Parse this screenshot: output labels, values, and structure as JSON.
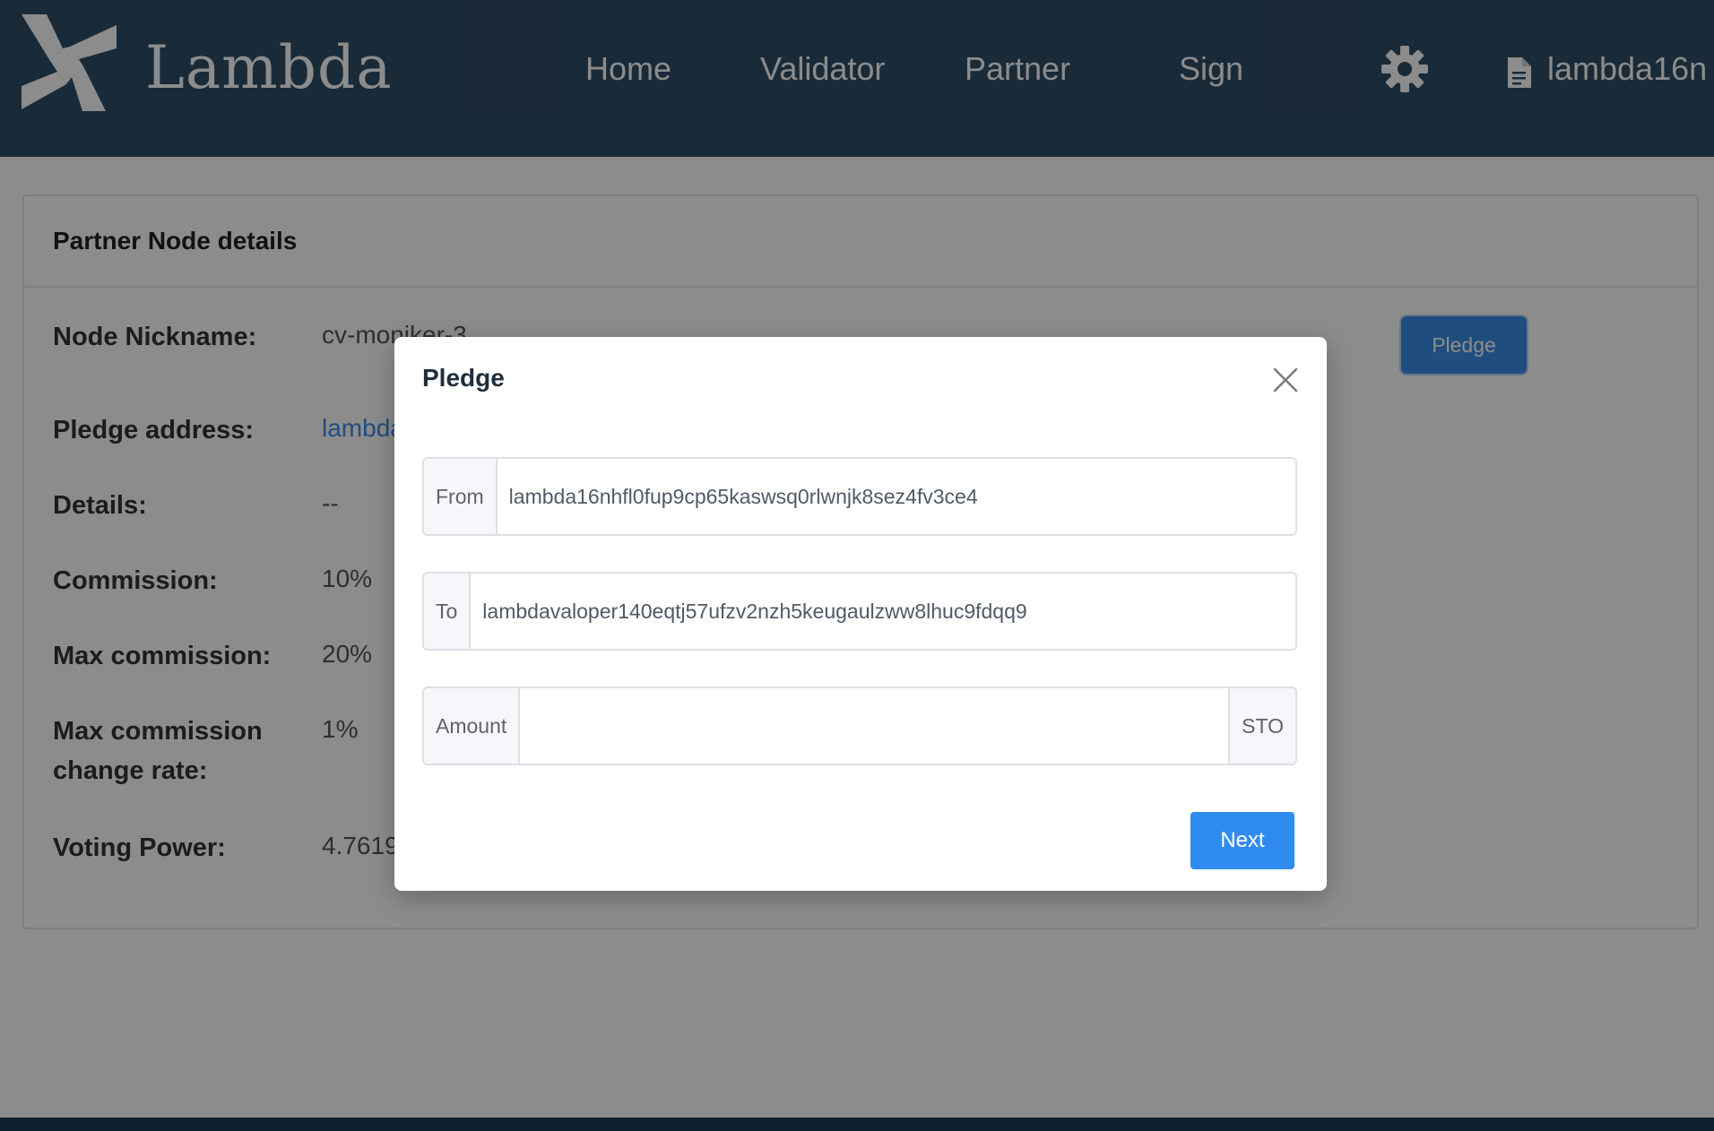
{
  "header": {
    "brand": "Lambda",
    "nav": [
      {
        "label": "Home"
      },
      {
        "label": "Validator"
      },
      {
        "label": "Partner"
      },
      {
        "label": "Sign"
      }
    ],
    "account_address": "lambda16n"
  },
  "card": {
    "title": "Partner Node details",
    "pledge_button": "Pledge",
    "rows": [
      {
        "label": "Node Nickname:",
        "value": "cv-moniker-3"
      },
      {
        "label": "Pledge address:",
        "value": "lambda"
      },
      {
        "label": "Details:",
        "value": "--"
      },
      {
        "label": "Commission:",
        "value": "10%"
      },
      {
        "label": "Max commission:",
        "value": "20%"
      },
      {
        "label": "Max commission change rate:",
        "value": "1%"
      },
      {
        "label": "Voting Power:",
        "value": "4.7619"
      }
    ]
  },
  "modal": {
    "title": "Pledge",
    "from_label": "From",
    "from_value": "lambda16nhfl0fup9cp65kaswsq0rlwnjk8sez4fv3ce4",
    "to_label": "To",
    "to_value": "lambdavaloper140eqtj57ufzv2nzh5keugaulzww8lhuc9fdqq9",
    "amount_label": "Amount",
    "amount_value": "",
    "amount_unit": "STO",
    "next_button": "Next"
  },
  "colors": {
    "header_bg": "#2f4d66",
    "primary": "#2f8cee",
    "link": "#3a8ee6",
    "overlay": "rgba(0,0,0,0.45)"
  },
  "icons": [
    "lambda-logo-icon",
    "gear-icon",
    "document-icon",
    "close-icon"
  ]
}
